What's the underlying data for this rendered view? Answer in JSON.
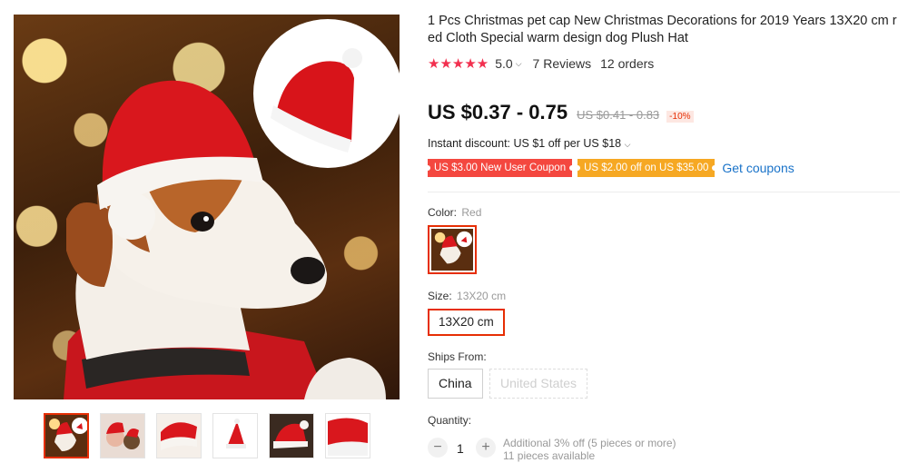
{
  "gallery": {
    "main_image_alt": "dog-with-santa-hat-image",
    "thumbnails": [
      {
        "name": "thumb-dog-santa-hat",
        "active": true
      },
      {
        "name": "thumb-girl-and-dog",
        "active": false
      },
      {
        "name": "thumb-hat-closeup",
        "active": false
      },
      {
        "name": "thumb-hat-white-bg",
        "active": false
      },
      {
        "name": "thumb-hat-angle",
        "active": false
      },
      {
        "name": "thumb-hat-large",
        "active": false
      }
    ]
  },
  "product": {
    "title": "1 Pcs Christmas pet cap New Christmas Decorations for 2019 Years 13X20 cm red Cloth Special warm design dog Plush Hat",
    "rating": {
      "stars": "★★★★★",
      "value": "5.0",
      "reviews": "7 Reviews",
      "orders": "12 orders"
    },
    "price": {
      "current": "US $0.37 - 0.75",
      "original": "US $0.41 - 0.83",
      "discount": "-10%"
    },
    "instant_discount": "Instant discount: US $1 off per US $18",
    "coupons": {
      "new_user": "US $3.00 New User Coupon",
      "store": "US $2.00 off on US $35.00",
      "get_link": "Get coupons"
    },
    "color": {
      "label": "Color:",
      "selected": "Red"
    },
    "size": {
      "label": "Size:",
      "selected": "13X20 cm",
      "options": [
        "13X20 cm"
      ]
    },
    "ships_from": {
      "label": "Ships From:",
      "options": [
        "China",
        "United States"
      ]
    },
    "quantity": {
      "label": "Quantity:",
      "minus": "−",
      "value": "1",
      "plus": "+",
      "note_line1": "Additional 3% off (5 pieces or more)",
      "note_line2": "11 pieces available"
    }
  },
  "colors": {
    "accent": "#e62e04",
    "star": "#f2304f",
    "coupon_red": "#f4473f",
    "coupon_orange": "#f6a823",
    "link": "#1a73c9"
  }
}
